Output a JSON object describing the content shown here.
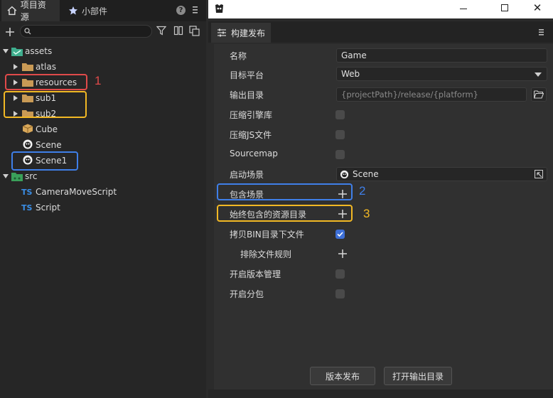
{
  "left_panel": {
    "tabs": [
      {
        "label": "项目资源",
        "icon": "home-icon"
      },
      {
        "label": "小部件",
        "icon": "star-icon"
      }
    ],
    "help_label": "?",
    "search": {
      "value": "",
      "placeholder": ""
    },
    "tree": [
      {
        "label": "assets",
        "icon": "folder-icon",
        "expanded": true
      },
      {
        "label": "atlas",
        "icon": "folder-icon"
      },
      {
        "label": "resources",
        "icon": "folder-icon"
      },
      {
        "label": "sub1",
        "icon": "folder-icon"
      },
      {
        "label": "sub2",
        "icon": "folder-icon"
      },
      {
        "label": "Cube",
        "icon": "cube-icon"
      },
      {
        "label": "Scene",
        "icon": "scene-icon"
      },
      {
        "label": "Scene1",
        "icon": "scene-icon"
      },
      {
        "label": "src",
        "icon": "folder-icon",
        "expanded": true
      },
      {
        "label": "CameraMoveScript",
        "icon": "ts-icon",
        "badge": "TS"
      },
      {
        "label": "Script",
        "icon": "ts-icon",
        "badge": "TS"
      }
    ],
    "annotations": [
      {
        "number": "1",
        "color": "#e04a4a"
      },
      {
        "number": "",
        "color": "#f2b824"
      },
      {
        "number": "",
        "color": "#3f7fe8"
      }
    ]
  },
  "right_panel": {
    "window_controls": {
      "close": "✕"
    },
    "tab": {
      "label": "构建发布",
      "icon": "sliders-icon"
    },
    "fields": {
      "name_label": "名称",
      "name_value": "Game",
      "platform_label": "目标平台",
      "platform_value": "Web",
      "output_label": "输出目录",
      "output_value": "{projectPath}/release/{platform}",
      "compress_engine_label": "压缩引擎库",
      "compress_js_label": "压缩JS文件",
      "sourcemap_label": "Sourcemap",
      "start_scene_label": "启动场景",
      "start_scene_value": "Scene",
      "include_scene_label": "包含场景",
      "always_include_label": "始终包含的资源目录",
      "copy_bin_label": "拷贝BIN目录下文件",
      "exclude_rules_label": "排除文件规则",
      "version_mgmt_label": "开启版本管理",
      "subpackage_label": "开启分包"
    },
    "checkboxes": {
      "compress_engine": false,
      "compress_js": false,
      "sourcemap": false,
      "copy_bin": true,
      "version_mgmt": false,
      "subpackage": false
    },
    "annotations": [
      {
        "number": "2",
        "color": "#3f7fe8"
      },
      {
        "number": "3",
        "color": "#f2b824"
      }
    ],
    "buttons": {
      "publish": "版本发布",
      "open_output": "打开输出目录"
    }
  }
}
